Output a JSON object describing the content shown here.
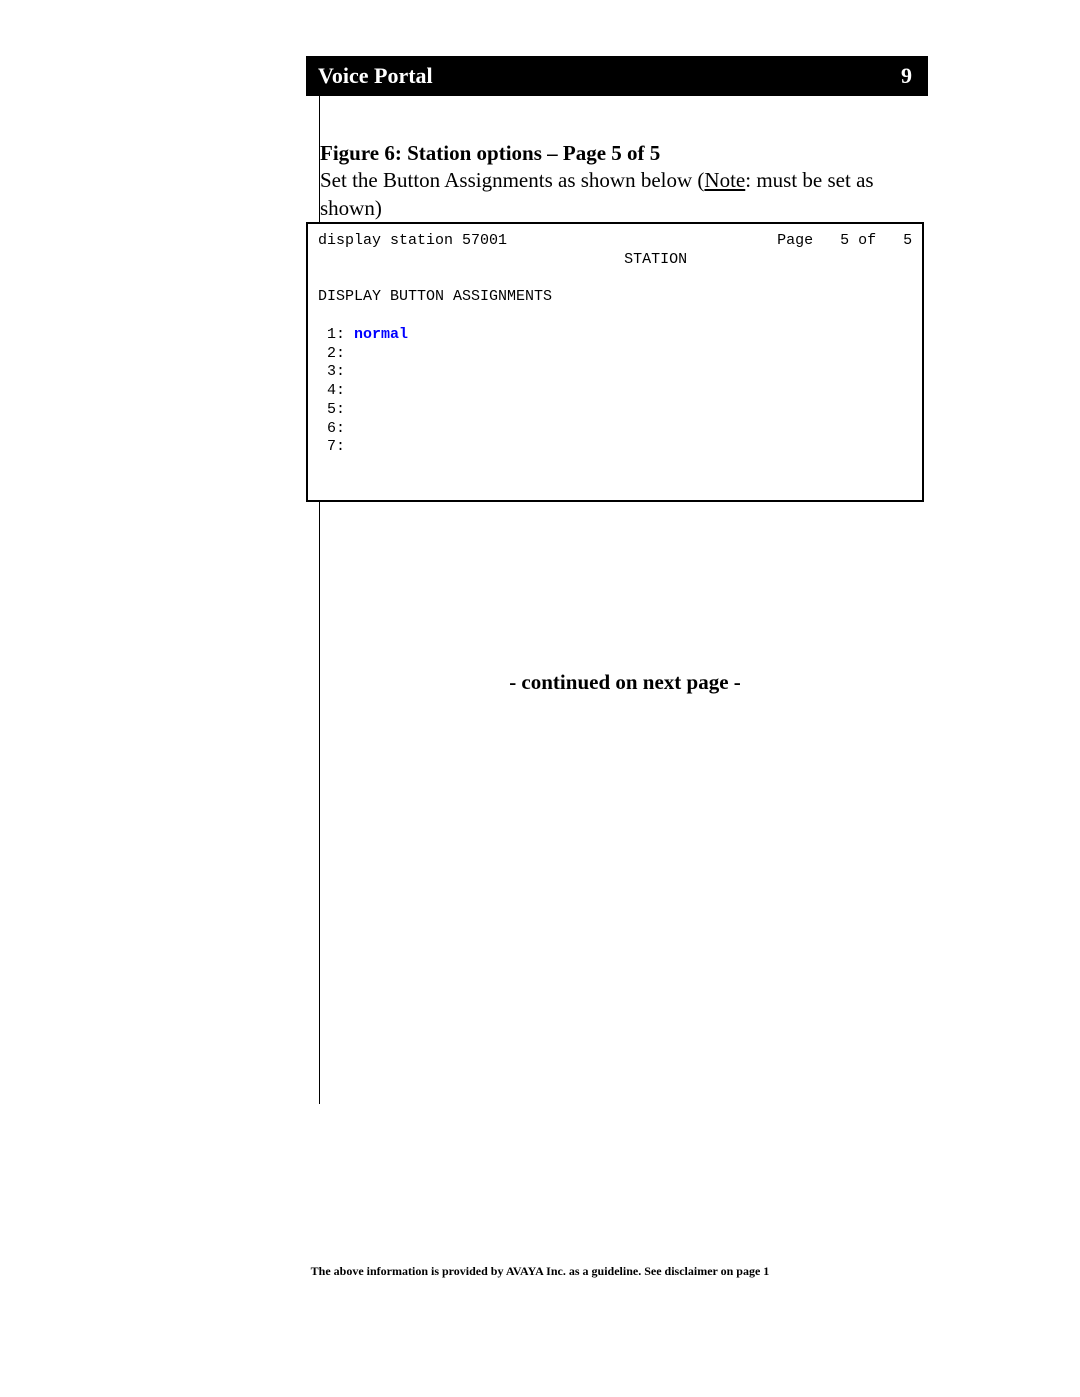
{
  "header": {
    "title": "Voice Portal",
    "page_number": "9"
  },
  "figure": {
    "title": "Figure 6: Station options – Page 5 of 5",
    "description_pre": "Set the Button Assignments as shown below (",
    "description_note": "Note",
    "description_post": ": must be set as shown)"
  },
  "terminal": {
    "line1_left": "display station 57001",
    "line1_right": "Page   5 of   5",
    "line2_center": "STATION",
    "line3": "DISPLAY BUTTON ASSIGNMENTS",
    "assignments": {
      "row1_num": " 1: ",
      "row1_val": "normal",
      "row2": " 2:",
      "row3": " 3:",
      "row4": " 4:",
      "row5": " 5:",
      "row6": " 6:",
      "row7": " 7:"
    }
  },
  "continued": "- continued on next page -",
  "footer": "The above information is provided by AVAYA Inc. as a guideline.  See disclaimer on page 1"
}
